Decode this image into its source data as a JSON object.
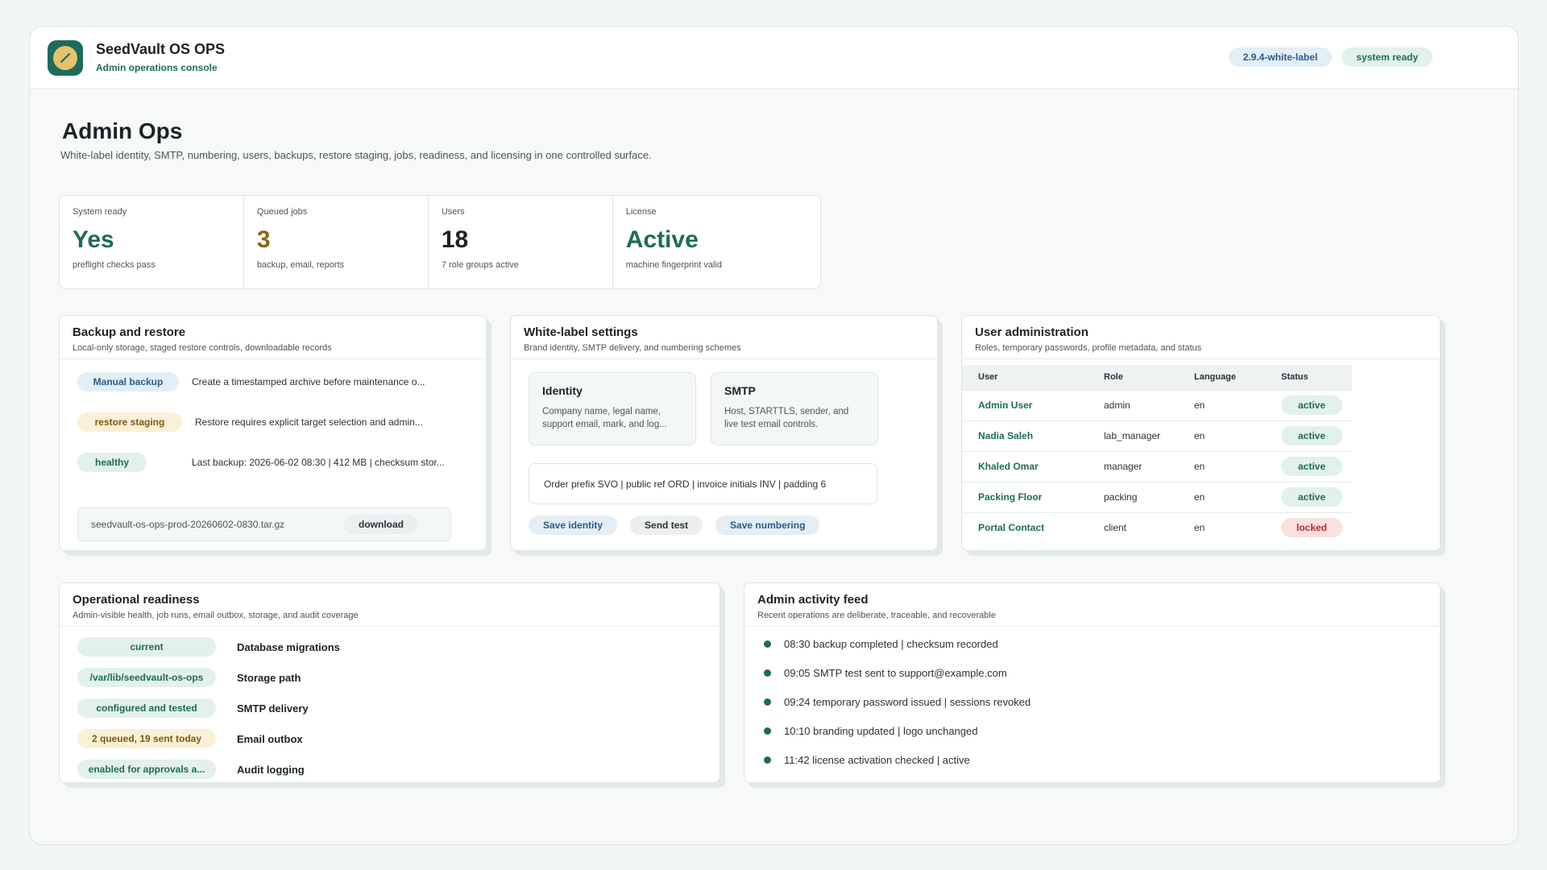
{
  "header": {
    "app_title": "SeedVault OS OPS",
    "app_subtitle": "Admin operations console",
    "version_badge": "2.9.4-white-label",
    "status_badge": "system ready"
  },
  "page": {
    "title": "Admin Ops",
    "subtitle": "White-label identity, SMTP, numbering, users, backups, restore staging, jobs, readiness, and licensing in one controlled surface."
  },
  "stats": [
    {
      "label": "System ready",
      "value": "Yes",
      "note": "preflight checks pass"
    },
    {
      "label": "Queued jobs",
      "value": "3",
      "note": "backup, email, reports"
    },
    {
      "label": "Users",
      "value": "18",
      "note": "7 role groups active"
    },
    {
      "label": "License",
      "value": "Active",
      "note": "machine fingerprint valid"
    }
  ],
  "backup": {
    "title": "Backup and restore",
    "subtitle": "Local-only storage, staged restore controls, downloadable records",
    "rows": [
      {
        "badge": "Manual backup",
        "text": "Create a timestamped archive before maintenance o..."
      },
      {
        "badge": "restore staging",
        "text": "Restore requires explicit target selection and admin..."
      },
      {
        "badge": "healthy",
        "text": "Last backup: 2026-06-02 08:30 | 412 MB | checksum stor..."
      }
    ],
    "file_name": "seedvault-os-ops-prod-20260602-0830.tar.gz",
    "download_label": "download"
  },
  "whitelabel": {
    "title": "White-label settings",
    "subtitle": "Brand identity, SMTP delivery, and numbering schemes",
    "identity_title": "Identity",
    "identity_text": "Company name, legal name, support email, mark, and log...",
    "smtp_title": "SMTP",
    "smtp_text": "Host, STARTTLS, sender, and live test email controls.",
    "numbering": "Order prefix SVO | public ref ORD | invoice initials INV | padding 6",
    "buttons": {
      "save_identity": "Save identity",
      "send_test": "Send test",
      "save_numbering": "Save numbering"
    }
  },
  "users": {
    "title": "User administration",
    "subtitle": "Roles, temporary passwords, profile metadata, and status",
    "columns": [
      "User",
      "Role",
      "Language",
      "Status"
    ],
    "rows": [
      {
        "user": "Admin User",
        "role": "admin",
        "language": "en",
        "status": "active"
      },
      {
        "user": "Nadia Saleh",
        "role": "lab_manager",
        "language": "en",
        "status": "active"
      },
      {
        "user": "Khaled Omar",
        "role": "manager",
        "language": "en",
        "status": "active"
      },
      {
        "user": "Packing Floor",
        "role": "packing",
        "language": "en",
        "status": "active"
      },
      {
        "user": "Portal Contact",
        "role": "client",
        "language": "en",
        "status": "locked"
      }
    ]
  },
  "readiness": {
    "title": "Operational readiness",
    "subtitle": "Admin-visible health, job runs, email outbox, storage, and audit coverage",
    "rows": [
      {
        "badge": "current",
        "label": "Database migrations"
      },
      {
        "badge": "/var/lib/seedvault-os-ops",
        "label": "Storage path"
      },
      {
        "badge": "configured and tested",
        "label": "SMTP delivery"
      },
      {
        "badge": "2 queued, 19 sent today",
        "label": "Email outbox"
      },
      {
        "badge": "enabled for approvals a...",
        "label": "Audit logging"
      }
    ]
  },
  "activity": {
    "title": "Admin activity feed",
    "subtitle": "Recent operations are deliberate, traceable, and recoverable",
    "items": [
      "08:30 backup completed | checksum recorded",
      "09:05 SMTP test sent to support@example.com",
      "09:24 temporary password issued | sessions revoked",
      "10:10 branding updated | logo unchanged",
      "11:42 license activation checked | active"
    ]
  }
}
